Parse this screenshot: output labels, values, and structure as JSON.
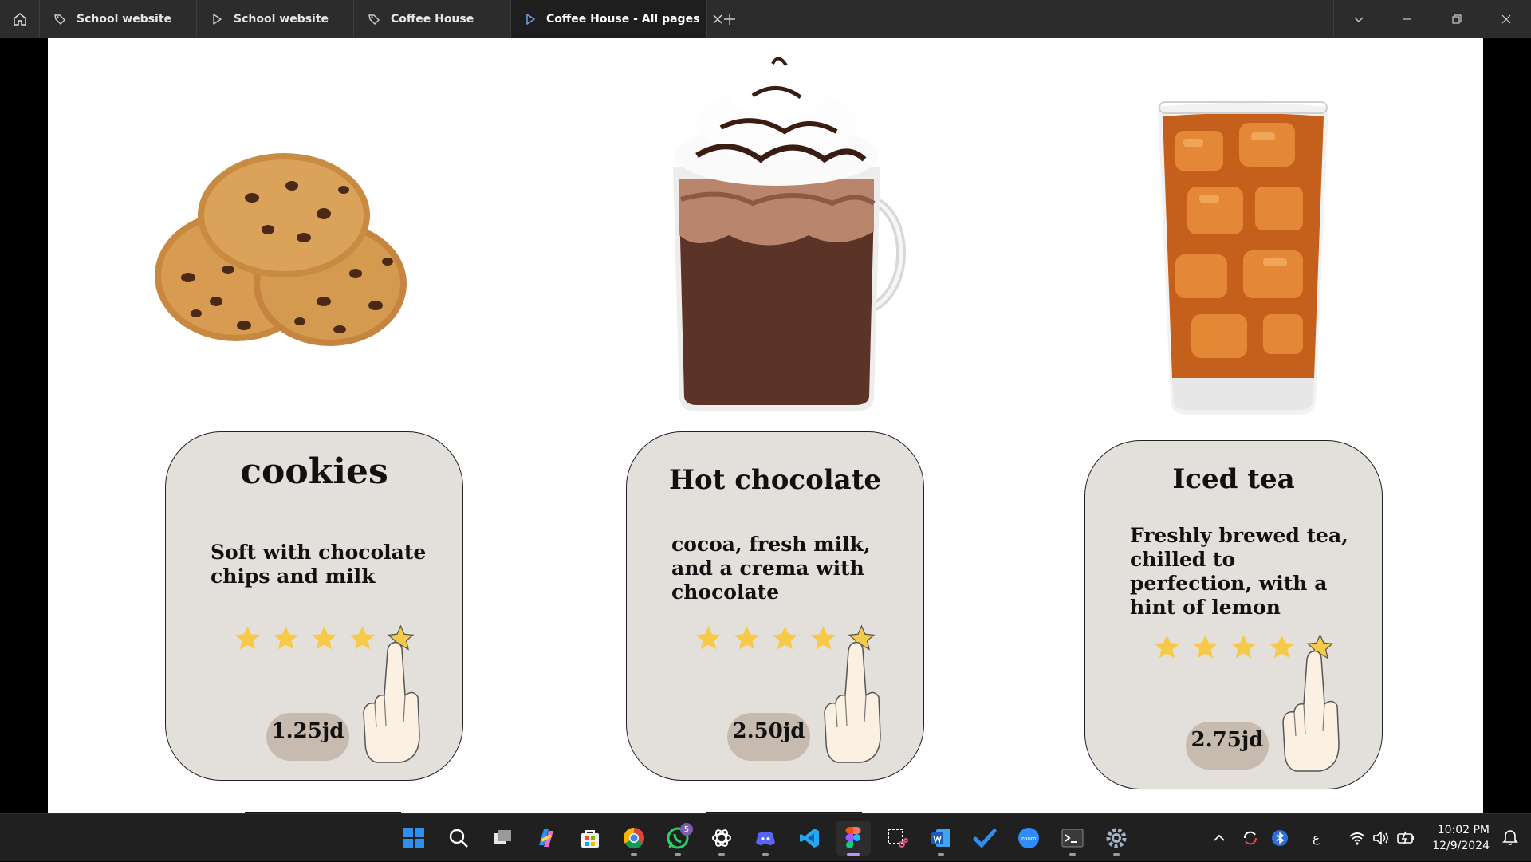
{
  "browser": {
    "tabs": [
      {
        "label": "School website",
        "icon": "prototype-icon",
        "active": false
      },
      {
        "label": "School website",
        "icon": "play-icon",
        "active": false
      },
      {
        "label": "Coffee House",
        "icon": "prototype-icon",
        "active": false
      },
      {
        "label": "Coffee House - All pages",
        "icon": "play-icon",
        "active": true
      }
    ]
  },
  "products": [
    {
      "name": "cookies",
      "description": "Soft with chocolate chips and milk",
      "rating": 5,
      "price": "1.25jd",
      "image": "cookies-photo"
    },
    {
      "name": "Hot chocolate",
      "description": "cocoa, fresh milk, and a crema with chocolate",
      "rating": 5,
      "price": "2.50jd",
      "image": "hot-chocolate-photo"
    },
    {
      "name": "Iced tea",
      "description": "Freshly brewed tea, chilled to perfection, with a hint of lemon",
      "rating": 5,
      "price": "2.75jd",
      "image": "iced-tea-photo"
    }
  ],
  "taskbar": {
    "apps": [
      "start",
      "search",
      "task-view",
      "copilot",
      "microsoft-store",
      "chrome",
      "whatsapp",
      "chatgpt",
      "discord",
      "vs-code",
      "figma",
      "snipping-tool",
      "word",
      "todo",
      "zoom",
      "terminal",
      "settings"
    ],
    "whatsapp_badge": "5",
    "keyboard_indicator": "ع",
    "time": "10:02 PM",
    "date": "12/9/2024"
  },
  "colors": {
    "card_bg": "#e3dfda",
    "price_pill": "#c7bbb0",
    "star": "#f7c948"
  }
}
